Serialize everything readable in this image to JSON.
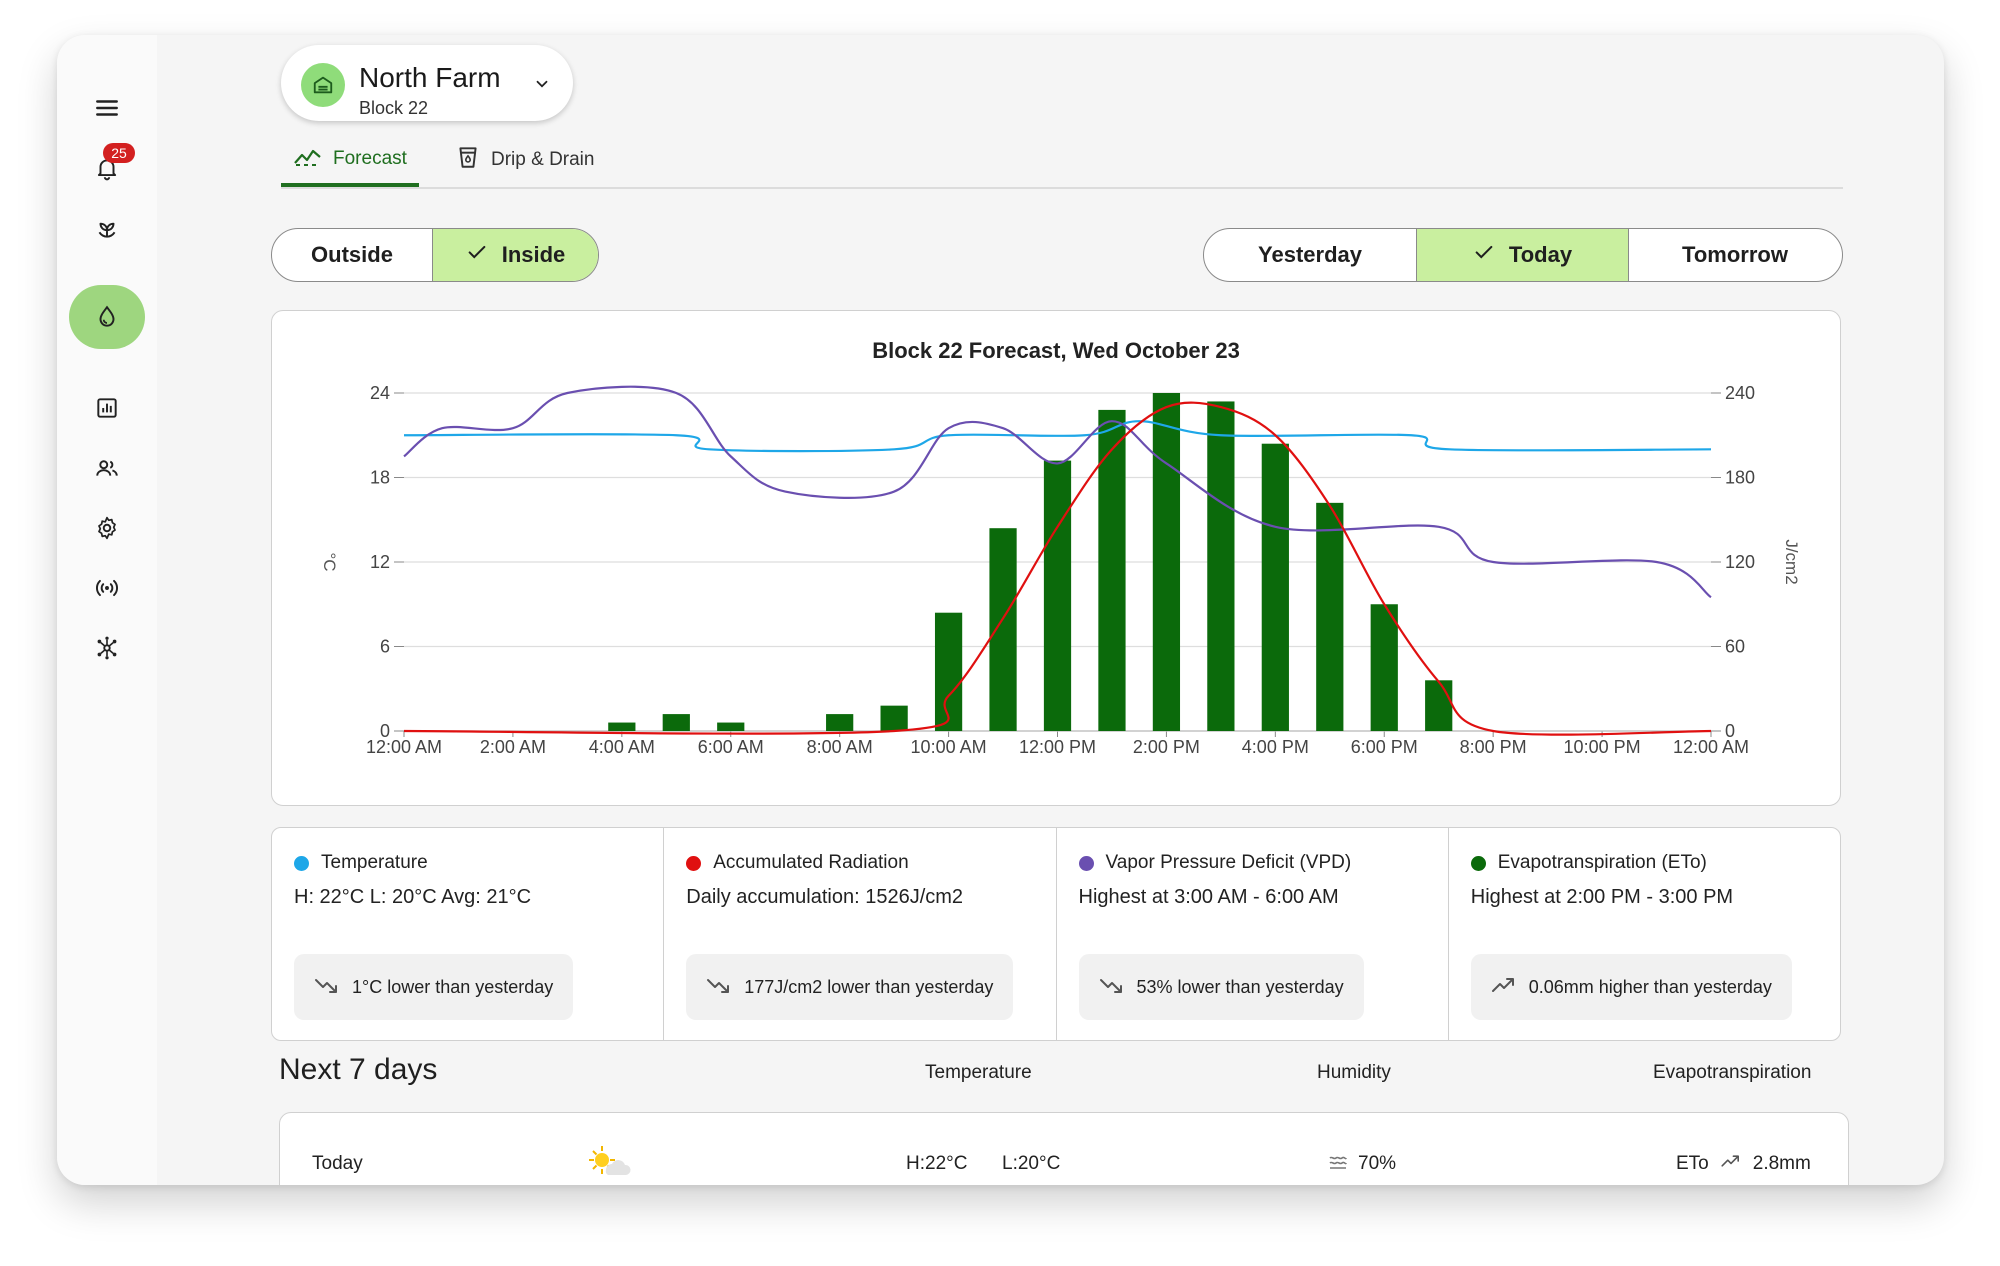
{
  "sidebar": {
    "notification_count": "25",
    "items": [
      "menu-icon",
      "bell-icon",
      "sprout-icon",
      "water-drop-icon",
      "report-icon",
      "people-icon",
      "gear-icon",
      "broadcast-icon",
      "network-icon"
    ]
  },
  "farm": {
    "name": "North Farm",
    "block": "Block 22"
  },
  "tabs": [
    {
      "label": "Forecast"
    },
    {
      "label": "Drip & Drain"
    }
  ],
  "location_toggle": {
    "outside": "Outside",
    "inside": "Inside",
    "selected": "Inside"
  },
  "day_toggle": {
    "yesterday": "Yesterday",
    "today": "Today",
    "tomorrow": "Tomorrow",
    "selected": "Today"
  },
  "colors": {
    "accent": "#1f6e1f",
    "active_bg": "#c9ef9f",
    "temperature": "#1ea7e8",
    "radiation": "#e01010",
    "vpd": "#6a4fb0",
    "eto": "#0b6a0b"
  },
  "chart_data": {
    "type": "bar",
    "title": "Block 22 Forecast, Wed October 23",
    "x_ticks": [
      "12:00 AM",
      "2:00 AM",
      "4:00 AM",
      "6:00 AM",
      "8:00 AM",
      "10:00 AM",
      "12:00 PM",
      "2:00 PM",
      "4:00 PM",
      "6:00 PM",
      "8:00 PM",
      "10:00 PM",
      "12:00 AM"
    ],
    "y_left": {
      "label": "°C",
      "ticks": [
        0,
        6,
        12,
        18,
        24
      ],
      "range": [
        0,
        24
      ]
    },
    "y_right": {
      "label": "J/cm2",
      "ticks": [
        0,
        60,
        120,
        180,
        240
      ],
      "range": [
        0,
        240
      ]
    },
    "x_range_hours": [
      0,
      24
    ],
    "grid": true,
    "series": [
      {
        "kind": "bar",
        "axis": "left",
        "color": "#0b6a0b",
        "points": [
          [
            4,
            0.6
          ],
          [
            5,
            1.2
          ],
          [
            6,
            0.6
          ],
          [
            8,
            1.2
          ],
          [
            9,
            1.8
          ],
          [
            10,
            8.4
          ],
          [
            11,
            14.4
          ],
          [
            12,
            19.2
          ],
          [
            13,
            22.8
          ],
          [
            14,
            24
          ],
          [
            15,
            23.4
          ],
          [
            16,
            20.4
          ],
          [
            17,
            16.2
          ],
          [
            18,
            9
          ],
          [
            19,
            3.6
          ]
        ]
      },
      {
        "kind": "line",
        "axis": "left",
        "color": "#1ea7e8",
        "points": [
          [
            0,
            21
          ],
          [
            5,
            21
          ],
          [
            5.6,
            20
          ],
          [
            9,
            20
          ],
          [
            10,
            21
          ],
          [
            12.5,
            21
          ],
          [
            13.5,
            22
          ],
          [
            15,
            21
          ],
          [
            18.5,
            21
          ],
          [
            19.2,
            20
          ],
          [
            24,
            20
          ]
        ]
      },
      {
        "kind": "line",
        "axis": "left",
        "color": "#6a4fb0",
        "points": [
          [
            0,
            19.5
          ],
          [
            0.7,
            21.5
          ],
          [
            2,
            21.5
          ],
          [
            3,
            24
          ],
          [
            5,
            24
          ],
          [
            6,
            19.5
          ],
          [
            7,
            17
          ],
          [
            9,
            17
          ],
          [
            10,
            21.5
          ],
          [
            11,
            21.5
          ],
          [
            12,
            19
          ],
          [
            13,
            22
          ],
          [
            14,
            19
          ],
          [
            16,
            14.5
          ],
          [
            19,
            14.5
          ],
          [
            20,
            12
          ],
          [
            23,
            12
          ],
          [
            24,
            9.5
          ]
        ]
      },
      {
        "kind": "line",
        "axis": "right",
        "color": "#e01010",
        "smooth": true,
        "points": [
          [
            0,
            0
          ],
          [
            9,
            0
          ],
          [
            10,
            25
          ],
          [
            11,
            80
          ],
          [
            12,
            145
          ],
          [
            13,
            200
          ],
          [
            14,
            230
          ],
          [
            15,
            230
          ],
          [
            16,
            210
          ],
          [
            17,
            160
          ],
          [
            18,
            90
          ],
          [
            19,
            35
          ],
          [
            20,
            0
          ],
          [
            24,
            0
          ]
        ]
      }
    ]
  },
  "stats": [
    {
      "name": "Temperature",
      "color": "#1ea7e8",
      "line": "H: 22°C L: 20°C Avg: 21°C",
      "trend": "down",
      "pill": "1°C lower than yesterday"
    },
    {
      "name": "Accumulated Radiation",
      "color": "#e01010",
      "line": "Daily accumulation: 1526J/cm2",
      "trend": "down",
      "pill": "177J/cm2 lower than yesterday"
    },
    {
      "name": "Vapor Pressure Deficit (VPD)",
      "color": "#6a4fb0",
      "line": "Highest at 3:00 AM - 6:00 AM",
      "trend": "down",
      "pill": "53% lower than yesterday"
    },
    {
      "name": "Evapotranspiration (ETo)",
      "color": "#0b6a0b",
      "line": "Highest at 2:00 PM - 3:00 PM",
      "trend": "up",
      "pill": "0.06mm higher than yesterday"
    }
  ],
  "next7": {
    "title": "Next 7 days",
    "col_temperature": "Temperature",
    "col_humidity": "Humidity",
    "col_eto": "Evapotranspiration",
    "rows": [
      {
        "day": "Today",
        "icon": "partly-sunny-icon",
        "high": "H:22°C",
        "low": "L:20°C",
        "humidity": "70%",
        "eto_label": "ETo",
        "eto": "2.8mm"
      }
    ]
  }
}
